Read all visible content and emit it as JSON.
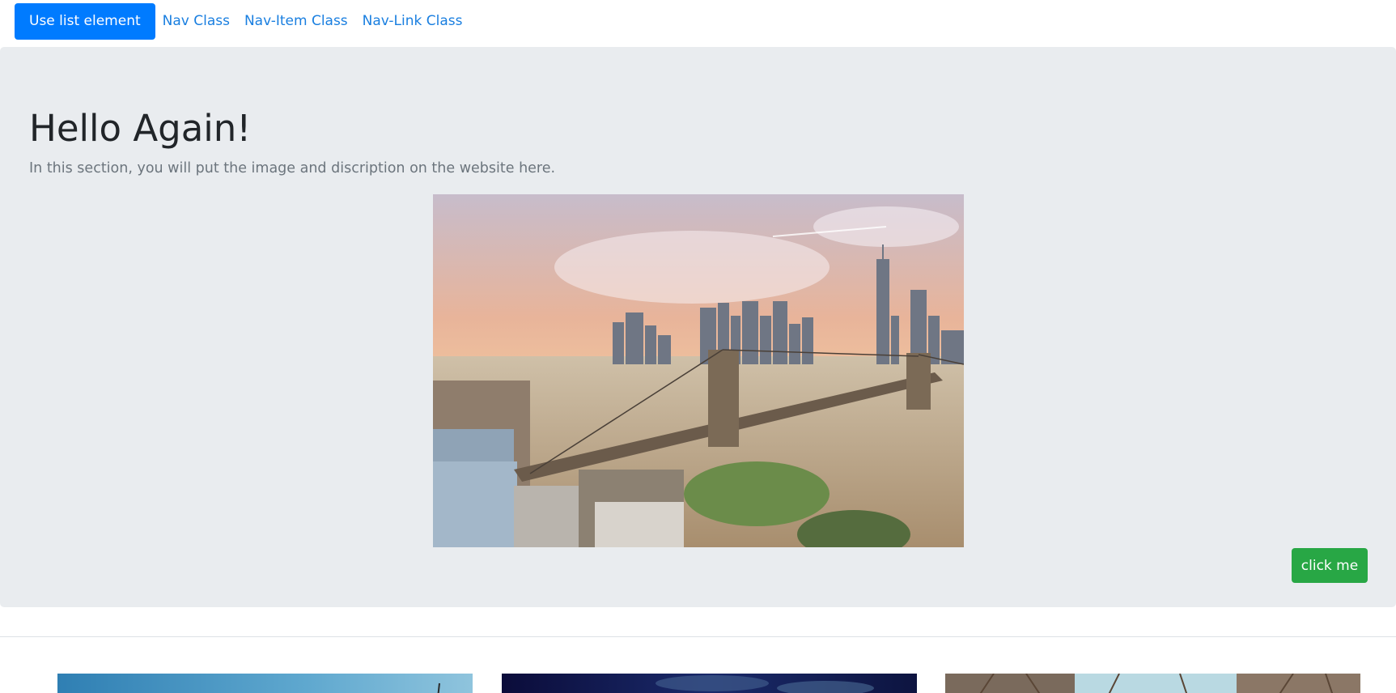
{
  "nav": {
    "items": [
      {
        "label": "Use list element",
        "active": true
      },
      {
        "label": "Nav Class",
        "active": false
      },
      {
        "label": "Nav-Item Class",
        "active": false
      },
      {
        "label": "Nav-Link Class",
        "active": false
      }
    ]
  },
  "hero": {
    "title": "Hello Again!",
    "lead": "In this section, you will put the image and discription on the website here.",
    "image": {
      "icon": "city-skyline-bridge-photo"
    },
    "button_label": "click me"
  },
  "cards": [
    {
      "icon": "sky-photo"
    },
    {
      "icon": "night-city-photo"
    },
    {
      "icon": "trees-photo"
    }
  ],
  "colors": {
    "primary": "#007bff",
    "link": "#1a7fe0",
    "success": "#28a745",
    "jumbotron_bg": "#e9ecef",
    "muted_text": "#6c757d"
  }
}
